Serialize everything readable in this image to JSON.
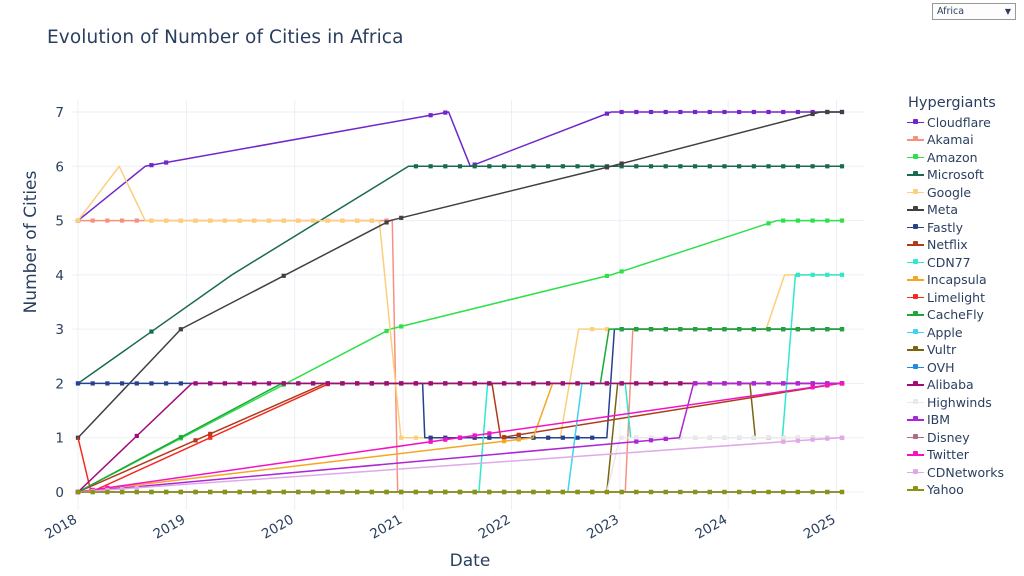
{
  "selector": {
    "value": "Africa",
    "icon": "chevron-down-icon"
  },
  "title": "Evolution of Number of Cities in Africa",
  "legend_title": "Hypergiants",
  "chart_data": {
    "type": "line",
    "title": "Evolution of Number of Cities in Africa",
    "xlabel": "Date",
    "ylabel": "Number of Cities",
    "xlim": [
      2018.0,
      2025.05
    ],
    "ylim": [
      -0.35,
      7.35
    ],
    "xticks": [
      "2018",
      "2019",
      "2020",
      "2021",
      "2022",
      "2023",
      "2024",
      "2025"
    ],
    "yticks": [
      "0",
      "1",
      "2",
      "3",
      "4",
      "5",
      "6",
      "7"
    ],
    "grid": true,
    "legend_position": "right",
    "marker": "square",
    "line_style": "step-post",
    "series": [
      {
        "name": "Cloudflare",
        "color": "#7026c9",
        "x": [
          2018.0,
          2018.62,
          2021.42,
          2021.62,
          2022.92,
          2025.03
        ],
        "values": [
          5,
          6,
          7,
          6,
          7,
          7
        ],
        "points": [
          {
            "x": 2018.0,
            "y": 5
          },
          {
            "x": 2018.62,
            "y": 6
          },
          {
            "x": 2021.42,
            "y": 7
          },
          {
            "x": 2021.62,
            "y": 6
          },
          {
            "x": 2022.92,
            "y": 7
          },
          {
            "x": 2025.03,
            "y": 7
          }
        ]
      },
      {
        "name": "Akamai",
        "color": "#f7917f",
        "x": [
          2018.0,
          2023.08,
          2025.03
        ],
        "values": [
          5,
          5,
          3
        ],
        "points": [
          {
            "x": 2018.0,
            "y": 5
          },
          {
            "x": 2020.9,
            "y": 5
          },
          {
            "x": 2020.95,
            "y": 0
          },
          {
            "x": 2023.05,
            "y": 0
          },
          {
            "x": 2023.12,
            "y": 3
          },
          {
            "x": 2025.03,
            "y": 3
          }
        ]
      },
      {
        "name": "Amazon",
        "color": "#2fe04a",
        "x": [
          2018.0,
          2020.88,
          2022.92,
          2024.45,
          2025.03
        ],
        "values": [
          0,
          3,
          4,
          5,
          5
        ],
        "points": [
          {
            "x": 2018.0,
            "y": 0
          },
          {
            "x": 2020.88,
            "y": 3
          },
          {
            "x": 2022.92,
            "y": 4
          },
          {
            "x": 2024.45,
            "y": 5
          },
          {
            "x": 2025.03,
            "y": 5
          }
        ]
      },
      {
        "name": "Microsoft",
        "color": "#1a6b4d",
        "x": [
          2018.0,
          2019.42,
          2021.05,
          2025.03
        ],
        "values": [
          2,
          4,
          6,
          6
        ],
        "points": [
          {
            "x": 2018.0,
            "y": 2
          },
          {
            "x": 2019.42,
            "y": 4
          },
          {
            "x": 2021.05,
            "y": 6
          },
          {
            "x": 2025.03,
            "y": 6
          }
        ]
      },
      {
        "name": "Google",
        "color": "#fccf7a",
        "x": [
          2018.0,
          2018.38,
          2018.62,
          2020.78,
          2023.05,
          2024.35,
          2025.03
        ],
        "values": [
          5,
          6,
          5,
          1,
          3,
          4,
          4
        ],
        "points": [
          {
            "x": 2018.0,
            "y": 5
          },
          {
            "x": 2018.38,
            "y": 6
          },
          {
            "x": 2018.62,
            "y": 5
          },
          {
            "x": 2020.78,
            "y": 5
          },
          {
            "x": 2020.98,
            "y": 1
          },
          {
            "x": 2022.45,
            "y": 1
          },
          {
            "x": 2022.62,
            "y": 3
          },
          {
            "x": 2024.35,
            "y": 3
          },
          {
            "x": 2024.52,
            "y": 4
          },
          {
            "x": 2025.03,
            "y": 4
          }
        ]
      },
      {
        "name": "Meta",
        "color": "#404040",
        "x": [
          2018.0,
          2018.95,
          2020.88,
          2022.92,
          2024.85,
          2025.03
        ],
        "values": [
          1,
          3,
          5,
          6,
          7,
          7
        ],
        "points": [
          {
            "x": 2018.0,
            "y": 1
          },
          {
            "x": 2018.95,
            "y": 3
          },
          {
            "x": 2020.88,
            "y": 5
          },
          {
            "x": 2022.92,
            "y": 6
          },
          {
            "x": 2024.85,
            "y": 7
          },
          {
            "x": 2025.03,
            "y": 7
          }
        ]
      },
      {
        "name": "Fastly",
        "color": "#27408f",
        "x": [
          2018.0,
          2021.18,
          2022.95,
          2025.03
        ],
        "values": [
          2,
          2,
          3,
          3
        ],
        "points": [
          {
            "x": 2018.0,
            "y": 2
          },
          {
            "x": 2021.18,
            "y": 2
          },
          {
            "x": 2021.2,
            "y": 1
          },
          {
            "x": 2022.88,
            "y": 1
          },
          {
            "x": 2022.95,
            "y": 3
          },
          {
            "x": 2025.03,
            "y": 3
          }
        ]
      },
      {
        "name": "Netflix",
        "color": "#b03a1a",
        "x": [
          2018.0,
          2020.28,
          2021.9,
          2025.03
        ],
        "values": [
          0,
          2,
          1,
          2
        ],
        "points": [
          {
            "x": 2018.0,
            "y": 0
          },
          {
            "x": 2020.28,
            "y": 2
          },
          {
            "x": 2021.82,
            "y": 2
          },
          {
            "x": 2021.9,
            "y": 1
          },
          {
            "x": 2025.03,
            "y": 2
          }
        ]
      },
      {
        "name": "CDN77",
        "color": "#2fe8d0",
        "x": [
          2018.0,
          2021.72,
          2023.05,
          2024.6,
          2025.03
        ],
        "values": [
          0,
          1,
          2,
          4,
          4
        ],
        "points": [
          {
            "x": 2018.0,
            "y": 0
          },
          {
            "x": 2021.7,
            "y": 0
          },
          {
            "x": 2021.78,
            "y": 2
          },
          {
            "x": 2023.05,
            "y": 2
          },
          {
            "x": 2023.1,
            "y": 1
          },
          {
            "x": 2024.5,
            "y": 1
          },
          {
            "x": 2024.62,
            "y": 4
          },
          {
            "x": 2025.03,
            "y": 4
          }
        ]
      },
      {
        "name": "Incapsula",
        "color": "#f5a623",
        "x": [
          2018.0,
          2022.3,
          2025.03
        ],
        "values": [
          0,
          2,
          2
        ],
        "points": [
          {
            "x": 2018.0,
            "y": 0
          },
          {
            "x": 2022.2,
            "y": 1
          },
          {
            "x": 2022.38,
            "y": 2
          },
          {
            "x": 2025.03,
            "y": 2
          }
        ]
      },
      {
        "name": "Limelight",
        "color": "#f5291f",
        "x": [
          2018.0,
          2018.12,
          2020.32,
          2025.03
        ],
        "values": [
          1,
          1,
          2,
          2
        ],
        "points": [
          {
            "x": 2018.0,
            "y": 1
          },
          {
            "x": 2018.12,
            "y": 0
          },
          {
            "x": 2020.32,
            "y": 2
          },
          {
            "x": 2025.03,
            "y": 2
          }
        ]
      },
      {
        "name": "CacheFly",
        "color": "#1aa83a",
        "x": [
          2018.0,
          2019.88,
          2022.88,
          2025.03
        ],
        "values": [
          0,
          2,
          3,
          3
        ],
        "points": [
          {
            "x": 2018.0,
            "y": 0
          },
          {
            "x": 2019.88,
            "y": 2
          },
          {
            "x": 2022.82,
            "y": 2
          },
          {
            "x": 2022.9,
            "y": 3
          },
          {
            "x": 2025.03,
            "y": 3
          }
        ]
      },
      {
        "name": "Apple",
        "color": "#3fd2f2",
        "x": [
          2018.0,
          2022.6,
          2025.03
        ],
        "values": [
          0,
          2,
          2
        ],
        "points": [
          {
            "x": 2018.0,
            "y": 0
          },
          {
            "x": 2022.52,
            "y": 0
          },
          {
            "x": 2022.65,
            "y": 2
          },
          {
            "x": 2025.03,
            "y": 2
          }
        ]
      },
      {
        "name": "Vultr",
        "color": "#7a6410",
        "x": [
          2018.0,
          2022.95,
          2024.2,
          2025.03
        ],
        "values": [
          0,
          2,
          1,
          1
        ],
        "points": [
          {
            "x": 2018.0,
            "y": 0
          },
          {
            "x": 2022.88,
            "y": 0
          },
          {
            "x": 2022.98,
            "y": 2
          },
          {
            "x": 2024.2,
            "y": 2
          },
          {
            "x": 2024.25,
            "y": 1
          },
          {
            "x": 2025.03,
            "y": 1
          }
        ]
      },
      {
        "name": "OVH",
        "color": "#1f8ae8",
        "x": [
          2018.0,
          2025.03
        ],
        "values": [
          0,
          0
        ],
        "points": [
          {
            "x": 2018.0,
            "y": 0
          },
          {
            "x": 2025.03,
            "y": 0
          }
        ]
      },
      {
        "name": "Alibaba",
        "color": "#a30a7a",
        "x": [
          2018.0,
          2019.05,
          2025.03
        ],
        "values": [
          0,
          2,
          2
        ],
        "points": [
          {
            "x": 2018.0,
            "y": 0
          },
          {
            "x": 2019.05,
            "y": 2
          },
          {
            "x": 2025.03,
            "y": 2
          }
        ]
      },
      {
        "name": "Highwinds",
        "color": "#ece7ea",
        "x": [
          2018.0,
          2022.95,
          2025.03
        ],
        "values": [
          0,
          1,
          1
        ],
        "points": [
          {
            "x": 2018.0,
            "y": 0
          },
          {
            "x": 2022.88,
            "y": 0
          },
          {
            "x": 2023.0,
            "y": 1
          },
          {
            "x": 2025.03,
            "y": 1
          }
        ]
      },
      {
        "name": "IBM",
        "color": "#ad25d6",
        "x": [
          2018.0,
          2023.6,
          2025.03
        ],
        "values": [
          0,
          2,
          2
        ],
        "points": [
          {
            "x": 2018.0,
            "y": 0
          },
          {
            "x": 2023.55,
            "y": 1
          },
          {
            "x": 2023.68,
            "y": 2
          },
          {
            "x": 2025.03,
            "y": 2
          }
        ]
      },
      {
        "name": "Disney",
        "color": "#b06a88",
        "x": [
          2018.0,
          2025.03
        ],
        "values": [
          0,
          0
        ],
        "points": [
          {
            "x": 2018.0,
            "y": 0
          },
          {
            "x": 2025.03,
            "y": 0
          }
        ]
      },
      {
        "name": "Twitter",
        "color": "#f511c4",
        "x": [
          2018.0,
          2025.03
        ],
        "values": [
          0,
          2
        ],
        "points": [
          {
            "x": 2018.0,
            "y": 0
          },
          {
            "x": 2025.03,
            "y": 2
          }
        ]
      },
      {
        "name": "CDNetworks",
        "color": "#dfa8e8",
        "x": [
          2018.0,
          2025.03
        ],
        "values": [
          0,
          1
        ],
        "points": [
          {
            "x": 2018.0,
            "y": 0
          },
          {
            "x": 2025.03,
            "y": 1
          }
        ]
      },
      {
        "name": "Yahoo",
        "color": "#8a9410",
        "x": [
          2018.0,
          2025.03
        ],
        "values": [
          0,
          0
        ],
        "points": [
          {
            "x": 2018.0,
            "y": 0
          },
          {
            "x": 2025.03,
            "y": 0
          }
        ]
      }
    ]
  }
}
